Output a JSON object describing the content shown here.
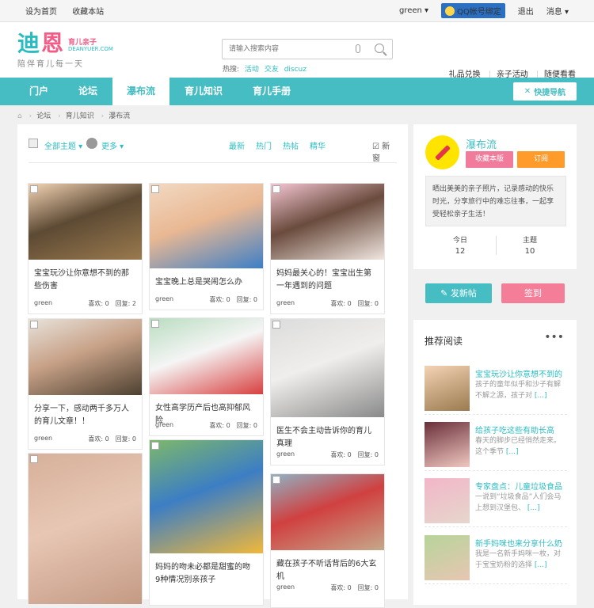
{
  "topbar": {
    "set_home": "设为首页",
    "bookmark": "收藏本站",
    "username": "green",
    "qq_bind": "QQ帐号绑定",
    "logout": "退出",
    "messages": "消息"
  },
  "logo": {
    "main_a": "迪",
    "main_b": "恩",
    "tag": "育儿亲子",
    "site": "DEANYUER.COM",
    "slogan": "陪伴育儿每一天"
  },
  "search": {
    "placeholder": "请输入搜索内容",
    "hot_label": "热搜:",
    "hot": [
      "活动",
      "交友",
      "discuz"
    ]
  },
  "header_links": [
    "礼品兑换",
    "亲子活动",
    "随便看看"
  ],
  "nav": {
    "items": [
      "门户",
      "论坛",
      "瀑布流",
      "育儿知识",
      "育儿手册"
    ],
    "quick": "快捷导航"
  },
  "breadcrumb": [
    "论坛",
    "育儿知识",
    "瀑布流"
  ],
  "filter": {
    "all_topics": "全部主题",
    "more": "更多",
    "tabs": [
      "最新",
      "热门",
      "热帖",
      "精华"
    ],
    "new_window": "新窗"
  },
  "cards": [
    {
      "title": "宝宝玩沙让你意想不到的那些伤害",
      "author": "green",
      "likes": "喜欢: 0",
      "replies": "回复: 2",
      "colors": [
        "#f3d3b4",
        "#9a7a4e",
        "#5d4a34"
      ]
    },
    {
      "title": "宝宝晚上总是哭闹怎么办",
      "author": "green",
      "likes": "喜欢: 0",
      "replies": "回复: 0",
      "colors": [
        "#f2d9c2",
        "#3d7fc6",
        "#e9b893"
      ]
    },
    {
      "title": "妈妈最关心的！宝宝出生第一年遇到的问题",
      "author": "green",
      "likes": "喜欢: 0",
      "replies": "回复: 0",
      "colors": [
        "#f4c6d3",
        "#f0e6e0",
        "#6a4b3d"
      ]
    },
    {
      "title": "分享一下，感动两千多万人的育儿文章！！",
      "author": "green",
      "likes": "喜欢: 0",
      "replies": "回复: 0",
      "colors": [
        "#e8e2da",
        "#4d4030",
        "#c7a187"
      ]
    },
    {
      "title": "女性高学历产后也高抑郁风险",
      "author": "green",
      "likes": "喜欢: 0",
      "replies": "回复: 0",
      "colors": [
        "#b9ddc0",
        "#d84040",
        "#f5f5f5"
      ]
    },
    {
      "title": "医生不会主动告诉你的育儿真理",
      "author": "green",
      "likes": "喜欢: 0",
      "replies": "回复: 0",
      "colors": [
        "#dcdcdc",
        "#8a8a8a",
        "#f0eeec"
      ]
    },
    {
      "title": "",
      "author": "",
      "likes": "",
      "replies": "",
      "colors": [
        "#d6b09a",
        "#c49a84",
        "#e7c7b4"
      ]
    },
    {
      "title": "妈妈的吻未必都是甜蜜的吻 9种情况别亲孩子",
      "author": "",
      "likes": "",
      "replies": "",
      "colors": [
        "#7db86a",
        "#f0b83a",
        "#3c7ec4"
      ]
    },
    {
      "title": "藏在孩子不听话背后的6大玄机",
      "author": "green",
      "likes": "喜欢: 0",
      "replies": "回复: 0",
      "colors": [
        "#8fb2c4",
        "#c6a88a",
        "#d04040"
      ]
    }
  ],
  "forum": {
    "name": "瀑布流",
    "fav_button": "收藏本版",
    "subscribe_button": "订阅",
    "description": "晒出美美的亲子照片，记录感动的快乐时光，分享旅行中的难忘往事，一起享受轻松亲子生活！",
    "today_label": "今日",
    "today_value": "12",
    "topics_label": "主题",
    "topics_value": "10"
  },
  "actions": {
    "post": "发新帖",
    "sign": "签到"
  },
  "recommend": {
    "heading": "推荐阅读",
    "more": "•••",
    "items": [
      {
        "title": "宝宝玩沙让你意想不到的",
        "snippet": "孩子的童年似乎和沙子有解不解之源，孩子对",
        "more": "[...]",
        "colors": [
          "#f3d3b4",
          "#9a7a4e"
        ]
      },
      {
        "title": "给孩子吃这些有助长高",
        "snippet": "春天的脚步已经悄然走来。这个季节",
        "more": "[...]",
        "colors": [
          "#6a2f3a",
          "#f0c8c0"
        ]
      },
      {
        "title": "专家盘点：儿童垃圾食品",
        "snippet": "一说到“垃圾食品”人们会马上想到汉堡包、",
        "more": "[...]",
        "colors": [
          "#f2b6c8",
          "#e6d6cc"
        ]
      },
      {
        "title": "新手妈咪也来分享什么奶",
        "snippet": "我是一名新手妈咪一枚，对于宝宝奶粉的选择",
        "more": "[...]",
        "colors": [
          "#b7d49a",
          "#e7c6b2"
        ]
      }
    ]
  }
}
